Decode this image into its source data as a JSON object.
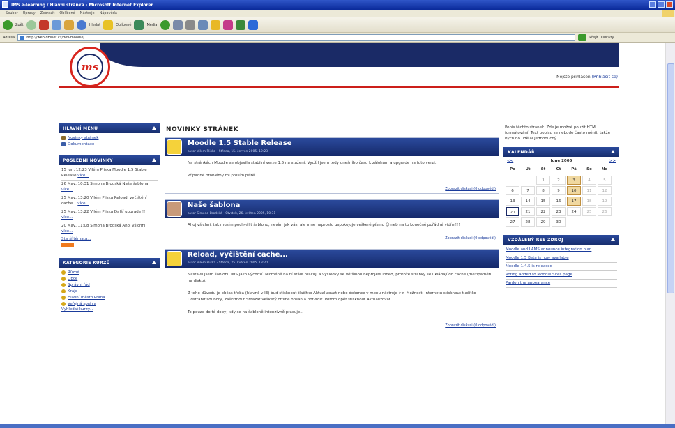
{
  "window": {
    "title": "IMS e-learning / Hlavní stránka - Microsoft Internet Explorer"
  },
  "menu": [
    "Soubor",
    "Úpravy",
    "Zobrazit",
    "Oblíbené",
    "Nástroje",
    "Nápověda"
  ],
  "toolbar": {
    "back": "Zpět",
    "search": "Hledat",
    "favorites": "Oblíbené",
    "media": "Média"
  },
  "address": {
    "label": "Adresa",
    "url": "http://web.dbinet.cz/dev-moodle/",
    "go": "Přejít",
    "links": "Odkazy"
  },
  "header": {
    "logo_text": "ms",
    "login_text": "Nejste přihlášen",
    "login_link": "(Přihlásit se)"
  },
  "left": {
    "main_menu": {
      "title": "HLAVNÍ MENU",
      "items": [
        "Novinky stránek",
        "Dokumentace"
      ]
    },
    "news": {
      "title": "POSLEDNÍ NOVINKY",
      "entries": [
        {
          "text": "15 Jun, 12:23 Vilém Pliska Moodle 1.5 Stable Release",
          "link": "více..."
        },
        {
          "text": "26 May, 10:31 Simona Brodská Naše šablona",
          "link": "více..."
        },
        {
          "text": "25 May, 13:20 Vilém Pliska Reload, vyčištění cache...",
          "link": "více..."
        },
        {
          "text": "25 May, 13:22 Vilém Pliska Další upgrade !!!",
          "link": "více..."
        },
        {
          "text": "20 May, 11:08 Simona Brodská Ahoj všichni",
          "link": "více..."
        }
      ],
      "older": "Starší témata...",
      "rss": "RSS"
    },
    "categories": {
      "title": "KATEGORIE KURZŮ",
      "items": [
        "Různé",
        "Obce",
        "Správní řád",
        "Kraje",
        "Hlavní město Praha",
        "Veřejná správa"
      ],
      "search": "Vyhledat kurzy..."
    }
  },
  "center": {
    "title": "NOVINKY STRÁNEK",
    "posts": [
      {
        "title": "Moodle 1.5 Stable Release",
        "meta": "autor Vilém Pliska - Středa, 15. červen 2005, 12:23",
        "paragraphs": [
          "Na stránkách Moodle se objevila stabilní verze 1.5 na stažení. Využil jsem tedy dnešního času k zálohám a upgrade na tuto verzi.",
          "Případné problémy mi prosím piště."
        ],
        "foot": "Zobrazit diskusi (0 odpovědí)"
      },
      {
        "title": "Naše šablona",
        "meta": "autor Simona Brodská - Čtvrtek, 26. květen 2005, 10:31",
        "paragraphs": [
          "Ahoj všichni, tak musím pochválit šablonu, nevím jak vás, ale mne naprosto uspokojuje veškeré písmo ☺ neb na to konečně pořádné vidím!!!"
        ],
        "foot": "Zobrazit diskusi (0 odpovědí)"
      },
      {
        "title": "Reload, vyčištění cache...",
        "meta": "autor Vilém Pliska - Středa, 25. květen 2005, 13:20",
        "paragraphs": [
          "Nastavil jsem šablonu IMS jako výchozí. Nicméně na ní stále pracuji a výsledky se většinou neprojeví ihned, protože stránky se ukládají do cache (mezipaměti na disku).",
          "Z toho důvodu je občas třeba (hlavně v IE) buď stisknout tlačítko Aktualizovat nebo dokonce v menu nástroje >> Možnosti Internetu stisknout tlačítko Odstranit soubory, zaškrtnout Smazat veškerý offline obsah a potvrdit. Potom opět stisknout Aktualizovat.",
          "To pouze do té doby, kdy se na šabloně intenzivně pracuje..."
        ],
        "foot": "Zobrazit diskusi (0 odpovědí)"
      }
    ]
  },
  "right": {
    "description": "Popis těchto stránek. Zde je možné použít HTML formátování. Text popisu se nebude často měnit, takže bych ho udělal jednoduchý.",
    "calendar": {
      "title": "KALENDÁŘ",
      "prev": "<<",
      "month": "June 2005",
      "next": ">>",
      "days": [
        "Po",
        "Út",
        "St",
        "Čt",
        "Pá",
        "So",
        "Ne"
      ],
      "cells": [
        "",
        "",
        "1",
        "2",
        "3",
        "4",
        "5",
        "6",
        "7",
        "8",
        "9",
        "10",
        "11",
        "12",
        "13",
        "14",
        "15",
        "16",
        "17",
        "18",
        "19",
        "20",
        "21",
        "22",
        "23",
        "24",
        "25",
        "26",
        "27",
        "28",
        "29",
        "30",
        "",
        "",
        ""
      ]
    },
    "rss": {
      "title": "VZDÁLENÝ RSS ZDROJ",
      "items": [
        "Moodle and LAMS announce integration plan",
        "Moodle 1.5 Beta is now available",
        "Moodle 1.4.5 is released",
        "Voting added to Moodle Sites page",
        "Pardon the appearance"
      ]
    }
  }
}
